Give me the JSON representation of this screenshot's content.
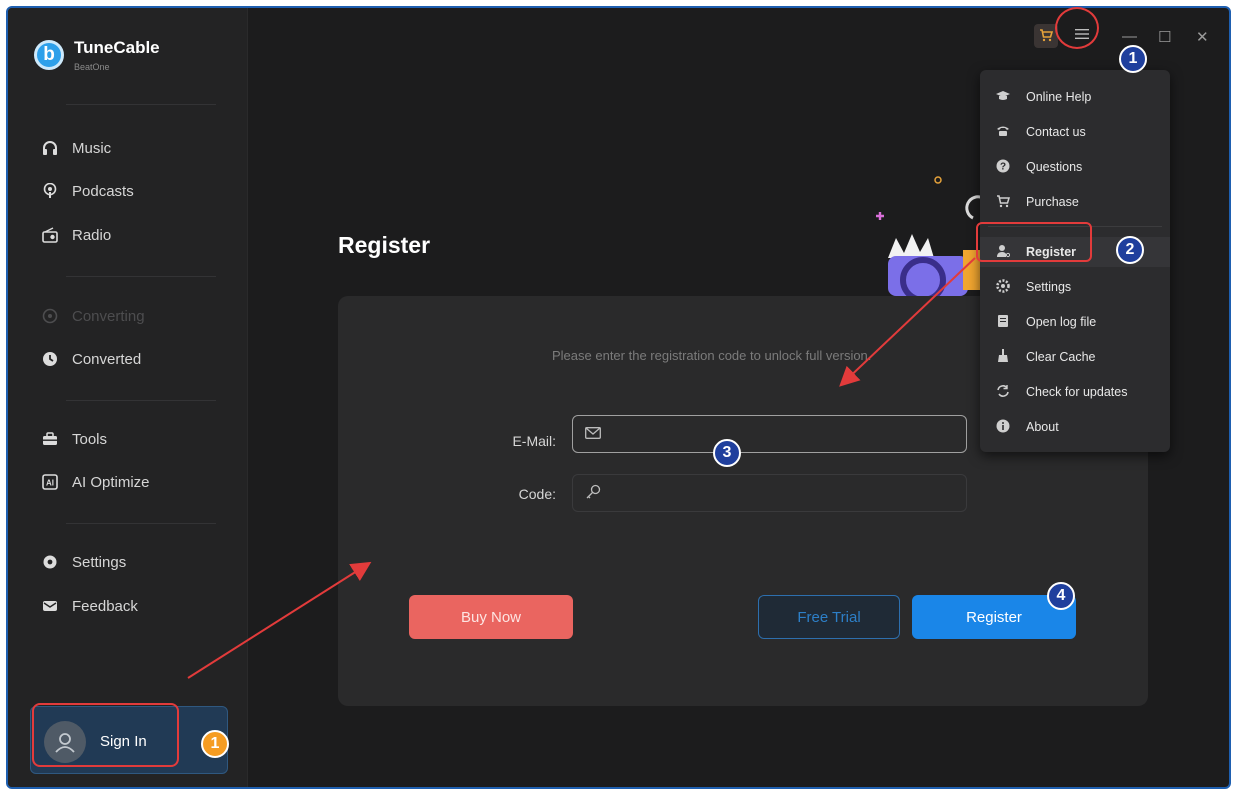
{
  "app": {
    "name": "TuneCable",
    "subtitle": "BeatOne"
  },
  "sidebar": {
    "items": [
      {
        "label": "Music",
        "icon": "headphones-icon"
      },
      {
        "label": "Podcasts",
        "icon": "podcast-icon"
      },
      {
        "label": "Radio",
        "icon": "radio-icon"
      },
      {
        "label": "Converting",
        "icon": "converting-icon",
        "disabled": true
      },
      {
        "label": "Converted",
        "icon": "clock-icon"
      },
      {
        "label": "Tools",
        "icon": "toolbox-icon"
      },
      {
        "label": "AI Optimize",
        "icon": "ai-icon"
      },
      {
        "label": "Settings",
        "icon": "gear-icon"
      },
      {
        "label": "Feedback",
        "icon": "mail-icon"
      }
    ],
    "signin_label": "Sign In"
  },
  "titlebar": {
    "cart_icon": "cart-icon",
    "menu_icon": "hamburger-icon",
    "minimize": "—",
    "maximize": "☐",
    "close": "✕"
  },
  "main": {
    "title": "Register",
    "hint": "Please enter the registration code to unlock full version.",
    "email_label": "E-Mail:",
    "code_label": "Code:",
    "buy_now": "Buy Now",
    "free_trial": "Free Trial",
    "register": "Register"
  },
  "menu": {
    "items": [
      {
        "label": "Online Help",
        "icon": "graduation-cap-icon"
      },
      {
        "label": "Contact us",
        "icon": "phone-icon"
      },
      {
        "label": "Questions",
        "icon": "question-icon"
      },
      {
        "label": "Purchase",
        "icon": "cart-icon"
      },
      {
        "label": "Register",
        "icon": "user-key-icon",
        "selected": true
      },
      {
        "label": "Settings",
        "icon": "gear-icon"
      },
      {
        "label": "Open log file",
        "icon": "file-icon"
      },
      {
        "label": "Clear Cache",
        "icon": "broom-icon"
      },
      {
        "label": "Check for updates",
        "icon": "refresh-icon"
      },
      {
        "label": "About",
        "icon": "info-icon"
      }
    ]
  },
  "badges": {
    "step1": "1",
    "step2": "2",
    "step3": "3",
    "step4": "4"
  },
  "colors": {
    "accent": "#1a86e8",
    "buy": "#ea6560",
    "highlight": "#e23b3b",
    "badge_blue": "#1f3f9d",
    "badge_orange": "#f59c22"
  }
}
